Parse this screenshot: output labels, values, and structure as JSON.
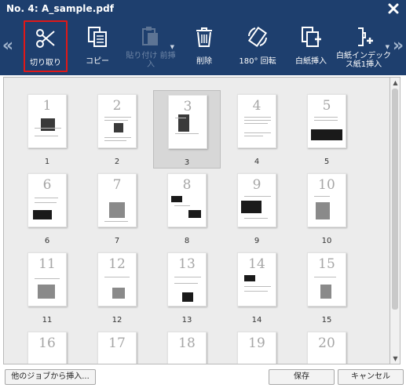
{
  "window": {
    "title": "No. 4: A_sample.pdf"
  },
  "toolbar": {
    "prev_label": "«",
    "next_label": "»",
    "tools": [
      {
        "id": "cut",
        "label": "切り取り",
        "icon": "scissors-icon",
        "state": "selected"
      },
      {
        "id": "copy",
        "label": "コピー",
        "icon": "copy-icon",
        "state": "enabled"
      },
      {
        "id": "paste",
        "label": "貼り付け 前挿入",
        "icon": "paste-icon",
        "state": "disabled"
      },
      {
        "id": "delete",
        "label": "削除",
        "icon": "trash-icon",
        "state": "enabled"
      },
      {
        "id": "rotate",
        "label": "180° 回転",
        "icon": "rotate-icon",
        "state": "enabled"
      },
      {
        "id": "insert_blank",
        "label": "白紙挿入",
        "icon": "insert-blank-icon",
        "state": "enabled"
      },
      {
        "id": "insert_index",
        "label": "白紙インデックス紙1挿入",
        "icon": "insert-index-icon",
        "state": "enabled"
      }
    ]
  },
  "pages": [
    {
      "number": "1",
      "caption": "1",
      "selected": false
    },
    {
      "number": "2",
      "caption": "2",
      "selected": false
    },
    {
      "number": "3",
      "caption": "3",
      "selected": true
    },
    {
      "number": "4",
      "caption": "4",
      "selected": false
    },
    {
      "number": "5",
      "caption": "5",
      "selected": false
    },
    {
      "number": "6",
      "caption": "6",
      "selected": false
    },
    {
      "number": "7",
      "caption": "7",
      "selected": false
    },
    {
      "number": "8",
      "caption": "8",
      "selected": false
    },
    {
      "number": "9",
      "caption": "9",
      "selected": false
    },
    {
      "number": "10",
      "caption": "10",
      "selected": false
    },
    {
      "number": "11",
      "caption": "11",
      "selected": false
    },
    {
      "number": "12",
      "caption": "12",
      "selected": false
    },
    {
      "number": "13",
      "caption": "13",
      "selected": false
    },
    {
      "number": "14",
      "caption": "14",
      "selected": false
    },
    {
      "number": "15",
      "caption": "15",
      "selected": false
    },
    {
      "number": "16",
      "caption": "",
      "selected": false
    },
    {
      "number": "17",
      "caption": "",
      "selected": false
    },
    {
      "number": "18",
      "caption": "",
      "selected": false
    },
    {
      "number": "19",
      "caption": "",
      "selected": false
    },
    {
      "number": "20",
      "caption": "",
      "selected": false
    }
  ],
  "buttons": {
    "insert_from_job": "他のジョブから挿入...",
    "save": "保存",
    "cancel": "キャンセル"
  },
  "colors": {
    "toolbar": "#1e3f6e",
    "selection_outline": "#e01818"
  }
}
